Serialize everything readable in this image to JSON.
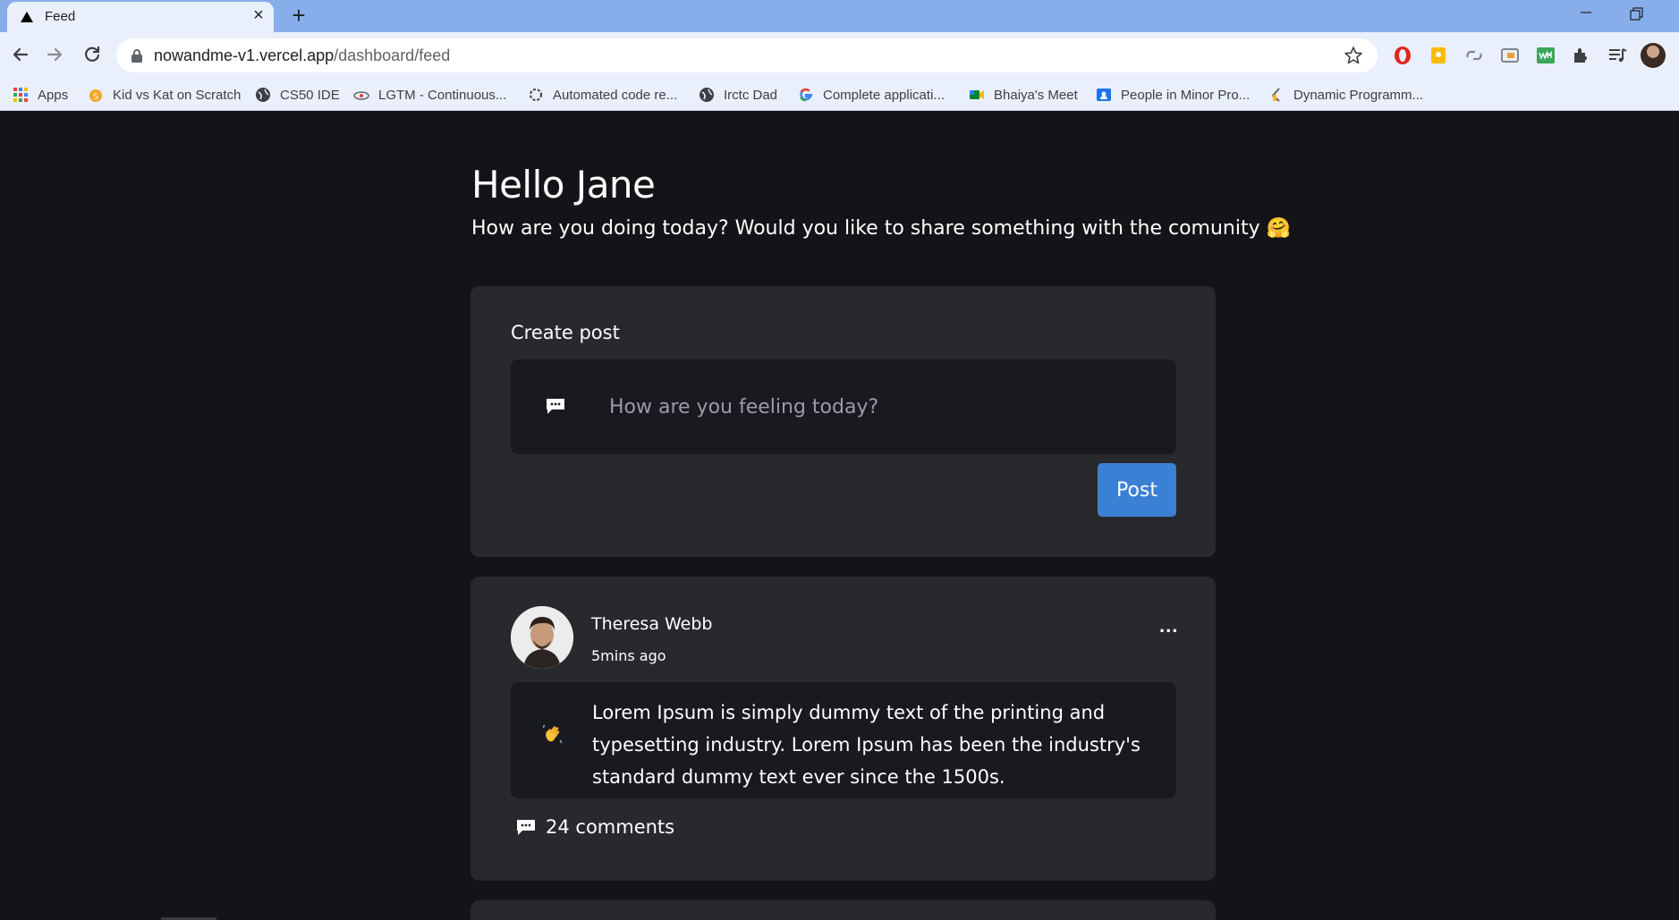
{
  "browser": {
    "tab_title": "Feed",
    "url_host": "nowandme-v1.vercel.app",
    "url_path": "/dashboard/feed",
    "bookmarks": [
      {
        "label": "Apps",
        "icon": "apps-grid-icon"
      },
      {
        "label": "Kid vs Kat on Scratch",
        "icon": "scratch-icon"
      },
      {
        "label": "CS50 IDE",
        "icon": "globe-icon"
      },
      {
        "label": "LGTM - Continuous...",
        "icon": "lgtm-icon"
      },
      {
        "label": "Automated code re...",
        "icon": "loading-spinner-icon"
      },
      {
        "label": "Irctc Dad",
        "icon": "globe-icon"
      },
      {
        "label": "Complete applicati...",
        "icon": "google-icon"
      },
      {
        "label": "Bhaiya's Meet",
        "icon": "meet-icon"
      },
      {
        "label": "People in Minor Pro...",
        "icon": "contacts-icon"
      },
      {
        "label": "Dynamic Programm...",
        "icon": "codeforces-icon"
      }
    ]
  },
  "feed": {
    "greeting": "Hello Jane",
    "subtitle": "How are you doing today? Would you like to share something with the comunity 🤗",
    "create_post": {
      "title": "Create post",
      "placeholder": "How are you feeling today?",
      "post_button": "Post"
    },
    "posts": [
      {
        "author": "Theresa Webb",
        "time": "5mins ago",
        "menu": "...",
        "emoji": "👋",
        "text": "Lorem Ipsum is simply dummy text of the printing and typesetting industry. Lorem Ipsum has been the industry's standard dummy text ever since the 1500s.",
        "comments": "24 comments"
      }
    ]
  },
  "colors": {
    "page_bg": "#131417",
    "card_bg": "#27292d",
    "input_bg": "#191920",
    "accent": "#3a80d4",
    "tab_bar": "#87aeea"
  }
}
